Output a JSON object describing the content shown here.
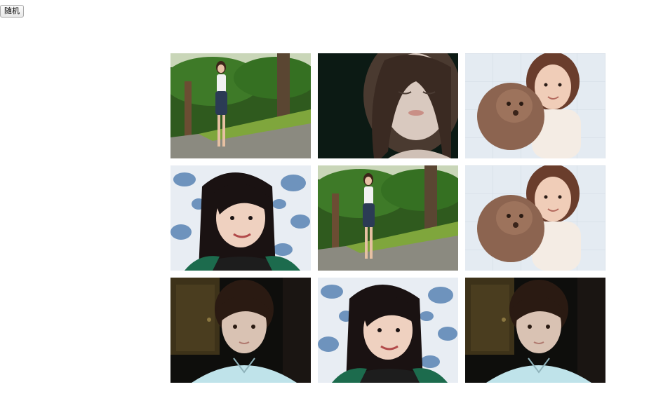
{
  "toolbar": {
    "random_label": "随机"
  },
  "gallery": {
    "photos": [
      {
        "subject": "girl-standing-garden"
      },
      {
        "subject": "girl-eyes-closed-dark"
      },
      {
        "subject": "girl-with-poodle"
      },
      {
        "subject": "girl-umbrella-smile"
      },
      {
        "subject": "girl-standing-garden"
      },
      {
        "subject": "girl-with-poodle"
      },
      {
        "subject": "girl-short-hair-room"
      },
      {
        "subject": "girl-umbrella-smile"
      },
      {
        "subject": "girl-short-hair-room"
      }
    ]
  }
}
